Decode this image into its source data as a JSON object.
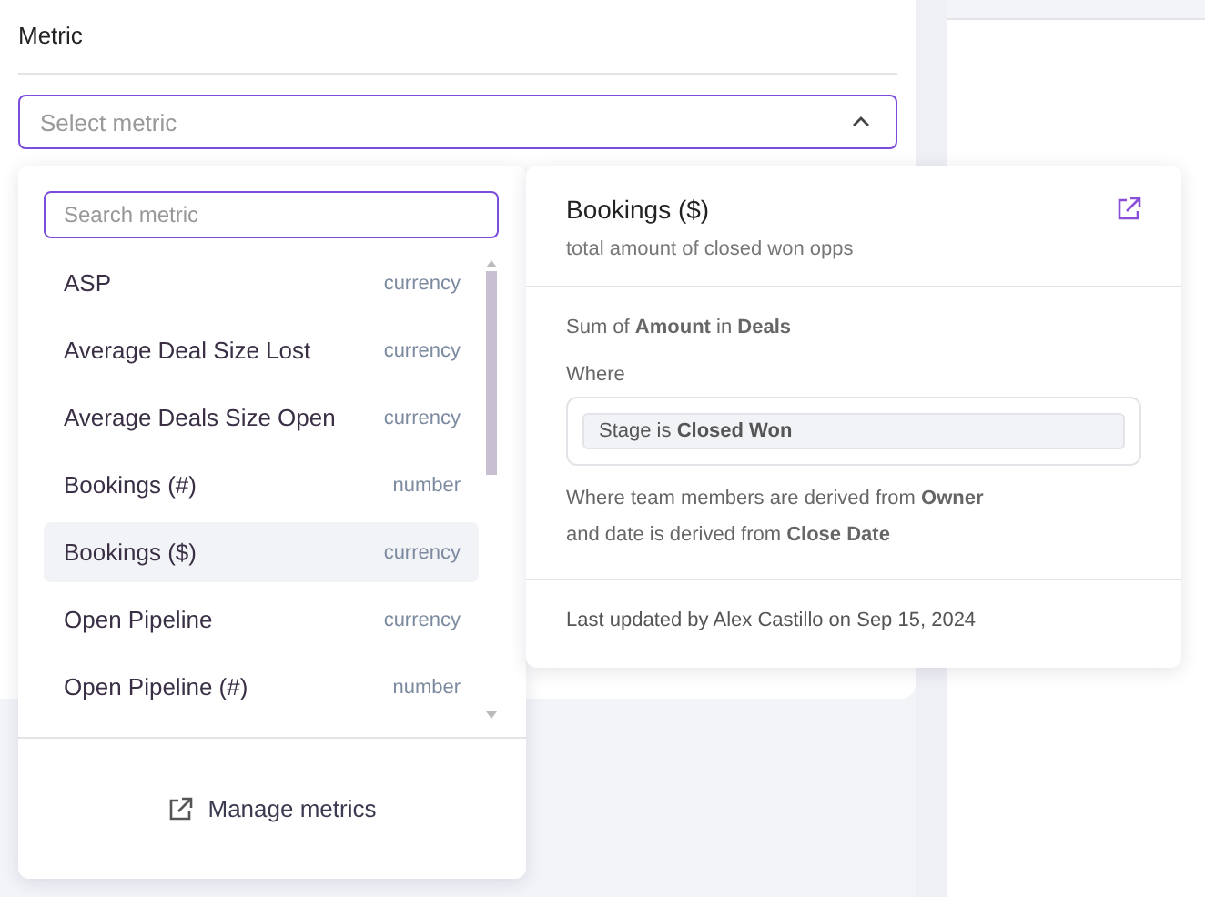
{
  "field": {
    "label": "Metric",
    "placeholder": "Select metric"
  },
  "dropdown": {
    "search_placeholder": "Search metric",
    "items": [
      {
        "name": "ASP",
        "type": "currency",
        "selected": false
      },
      {
        "name": "Average Deal Size Lost",
        "type": "currency",
        "selected": false
      },
      {
        "name": "Average Deals Size Open",
        "type": "currency",
        "selected": false
      },
      {
        "name": "Bookings (#)",
        "type": "number",
        "selected": false
      },
      {
        "name": "Bookings ($)",
        "type": "currency",
        "selected": true
      },
      {
        "name": "Open Pipeline",
        "type": "currency",
        "selected": false
      },
      {
        "name": "Open Pipeline (#)",
        "type": "number",
        "selected": false
      }
    ],
    "footer_link": "Manage metrics"
  },
  "details": {
    "title": "Bookings ($)",
    "description": "total amount of closed won opps",
    "formula": "Sum of **Amount** in **Deals**",
    "where_label": "Where",
    "condition": "Stage is **Closed Won**",
    "derivation": [
      "Where team members are derived from **Owner**",
      "and date is derived from **Close Date**"
    ],
    "updated": "Last updated by Alex Castillo on Sep 15, 2024"
  }
}
